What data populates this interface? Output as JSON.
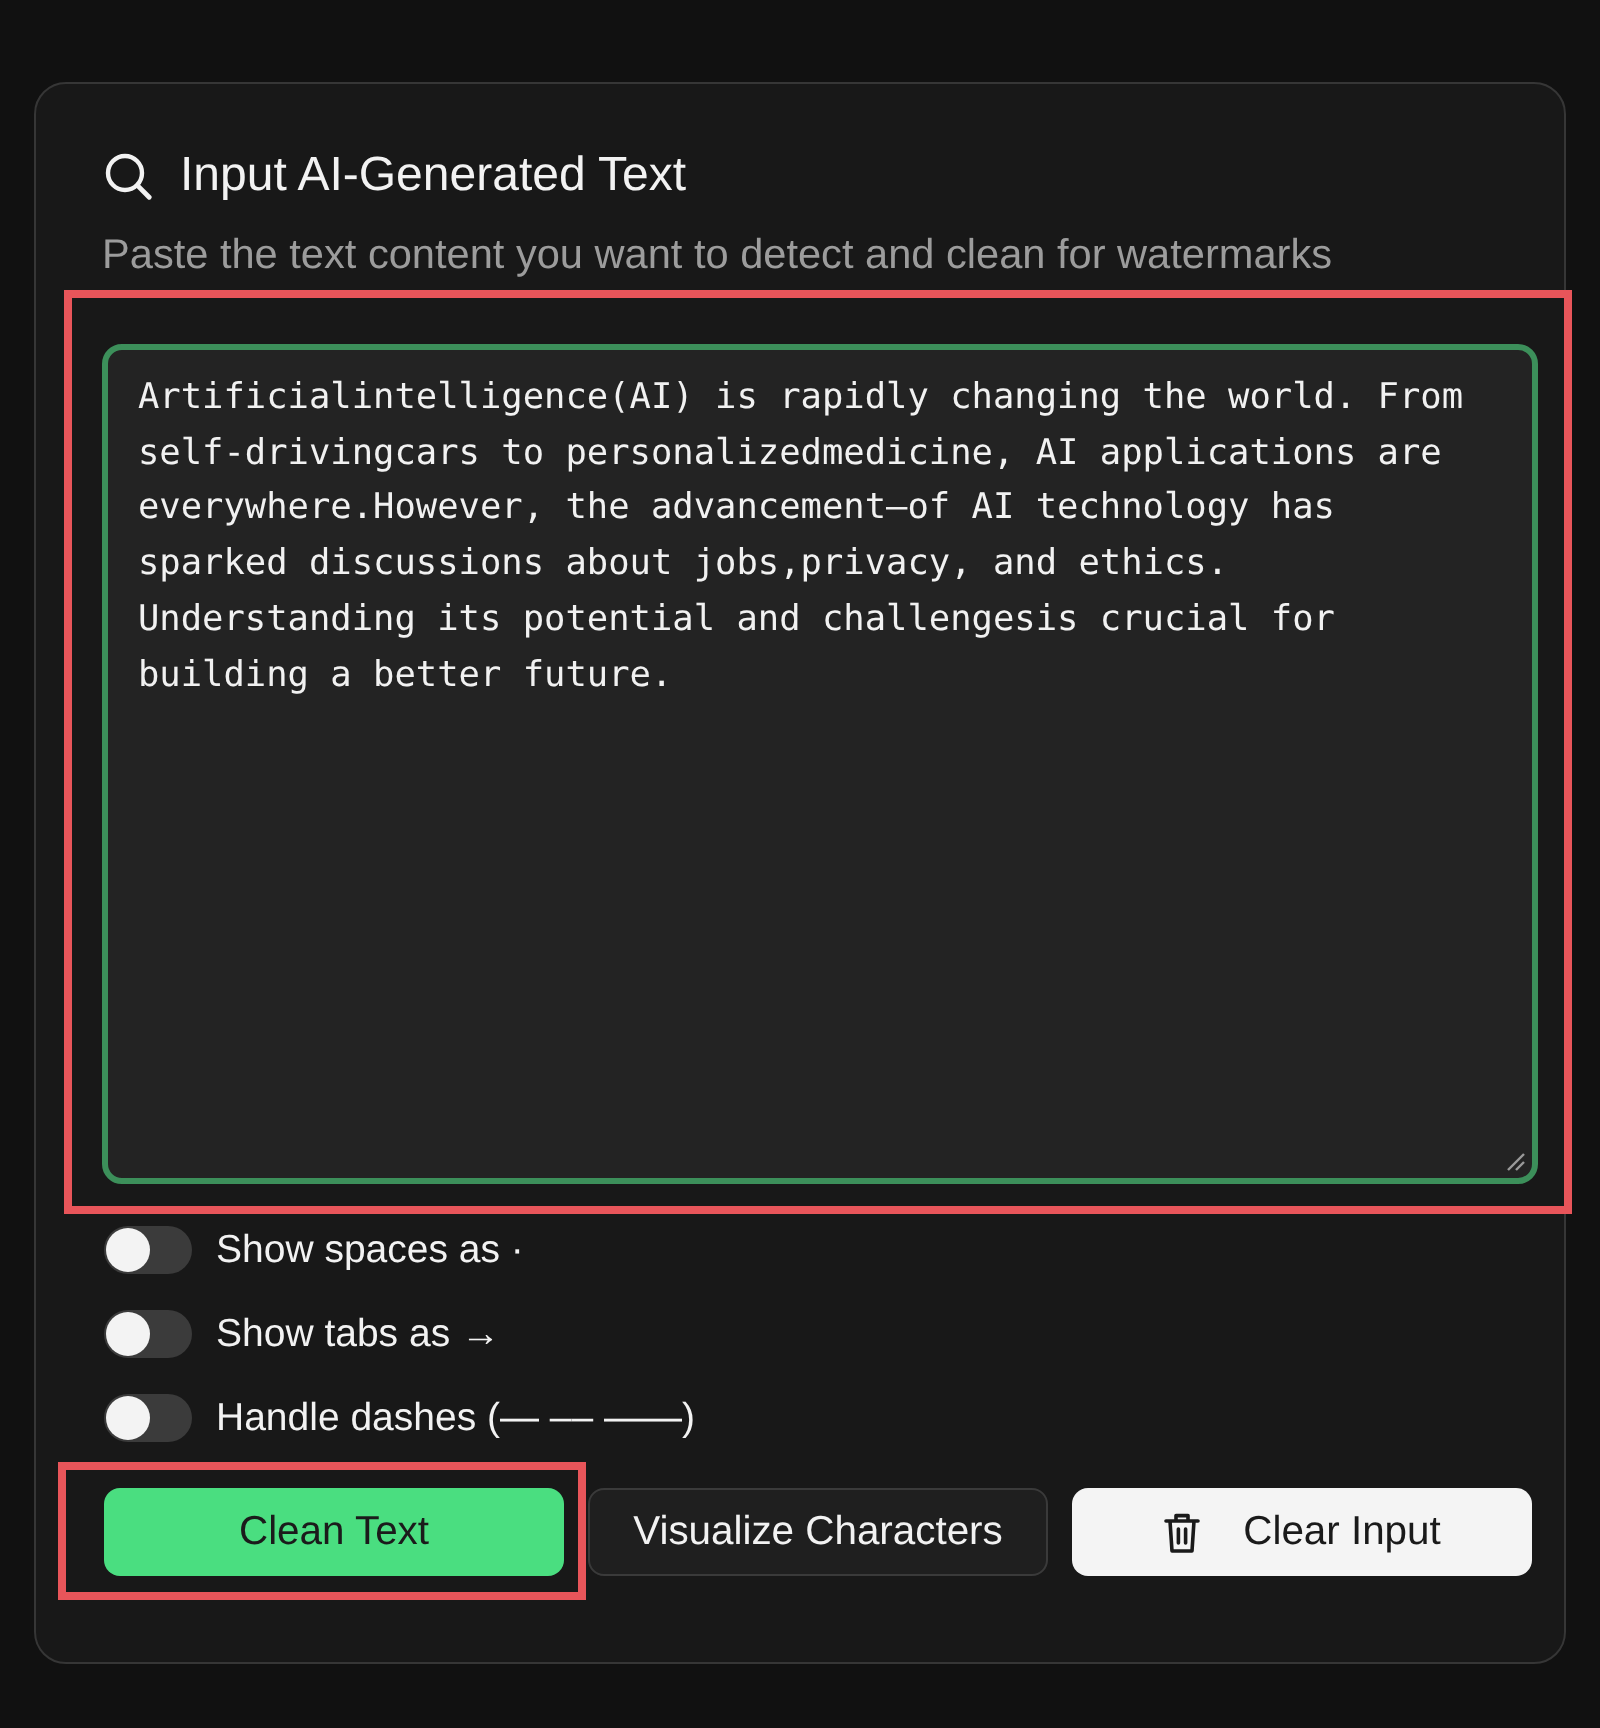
{
  "header": {
    "title": "Input AI-Generated Text",
    "subtitle": "Paste the text content you want to detect and clean for watermarks"
  },
  "input": {
    "value": "Artificialintelligence(AI) is rapidly changing the world. From self-drivingcars to personalizedmedicine, AI applications are everywhere.However, the advancement—of AI technology has sparked discussions about jobs,privacy, and ethics. Understanding its potential and challengesis crucial for building a better future.",
    "highlighted": true
  },
  "options": [
    {
      "label": "Show spaces as ·",
      "on": false
    },
    {
      "label": "Show tabs as →",
      "on": false
    },
    {
      "label": "Handle dashes (— –– ——)",
      "on": false
    }
  ],
  "buttons": [
    {
      "label": "Clean Text",
      "kind": "primary",
      "highlighted": true
    },
    {
      "label": "Visualize Characters",
      "kind": "outline",
      "highlighted": false
    },
    {
      "label": "Clear Input",
      "kind": "clear",
      "highlighted": false
    }
  ]
}
